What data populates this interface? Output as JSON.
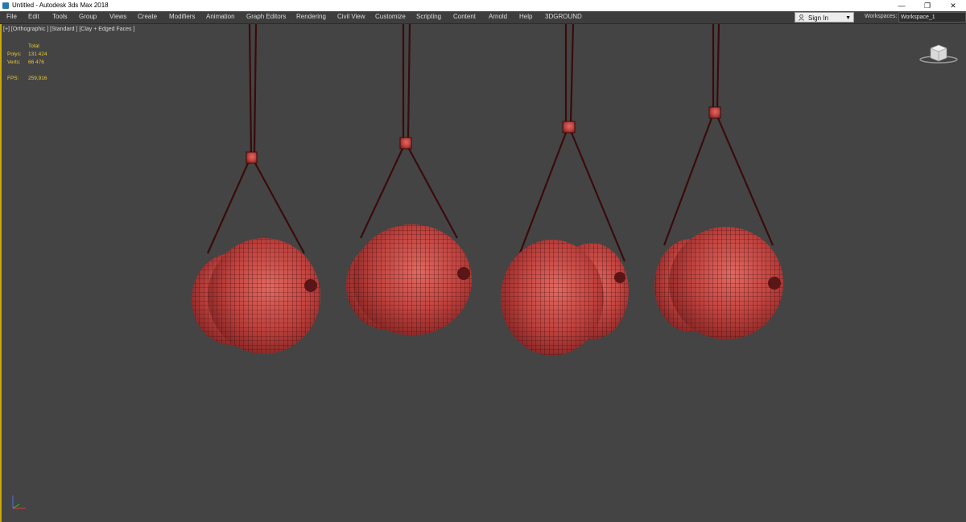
{
  "window": {
    "title": "Untitled - Autodesk 3ds Max 2018",
    "controls": [
      "—",
      "❐",
      "✕"
    ]
  },
  "menu": {
    "items": [
      "File",
      "Edit",
      "Tools",
      "Group",
      "Views",
      "Create",
      "Modifiers",
      "Animation",
      "Graph Editors",
      "Rendering",
      "Civil View",
      "Customize",
      "Scripting",
      "Content",
      "Arnold",
      "Help",
      "3DGROUND"
    ]
  },
  "account": {
    "sign_in": "Sign In",
    "workspaces_label": "Workspaces:",
    "workspace_value": "Workspace_1"
  },
  "viewport": {
    "label": "[+] [Orthographic ] [Standard ] [Clay + Edged Faces ]",
    "stats": {
      "header": "Total",
      "polys_label": "Polys:",
      "polys_value": "131 424",
      "verts_label": "Verts:",
      "verts_value": "66 476",
      "fps_label": "FPS:",
      "fps_value": "259,916"
    }
  },
  "colors": {
    "viewport_bg": "#444444",
    "object_red": "#c0433f",
    "wire": "#3a0b0c",
    "stats_yellow": "#e6cd3a",
    "active_border": "#c9a90a"
  },
  "icons": [
    "app-icon",
    "user-icon",
    "viewcube-icon",
    "axis-tripod-icon"
  ]
}
